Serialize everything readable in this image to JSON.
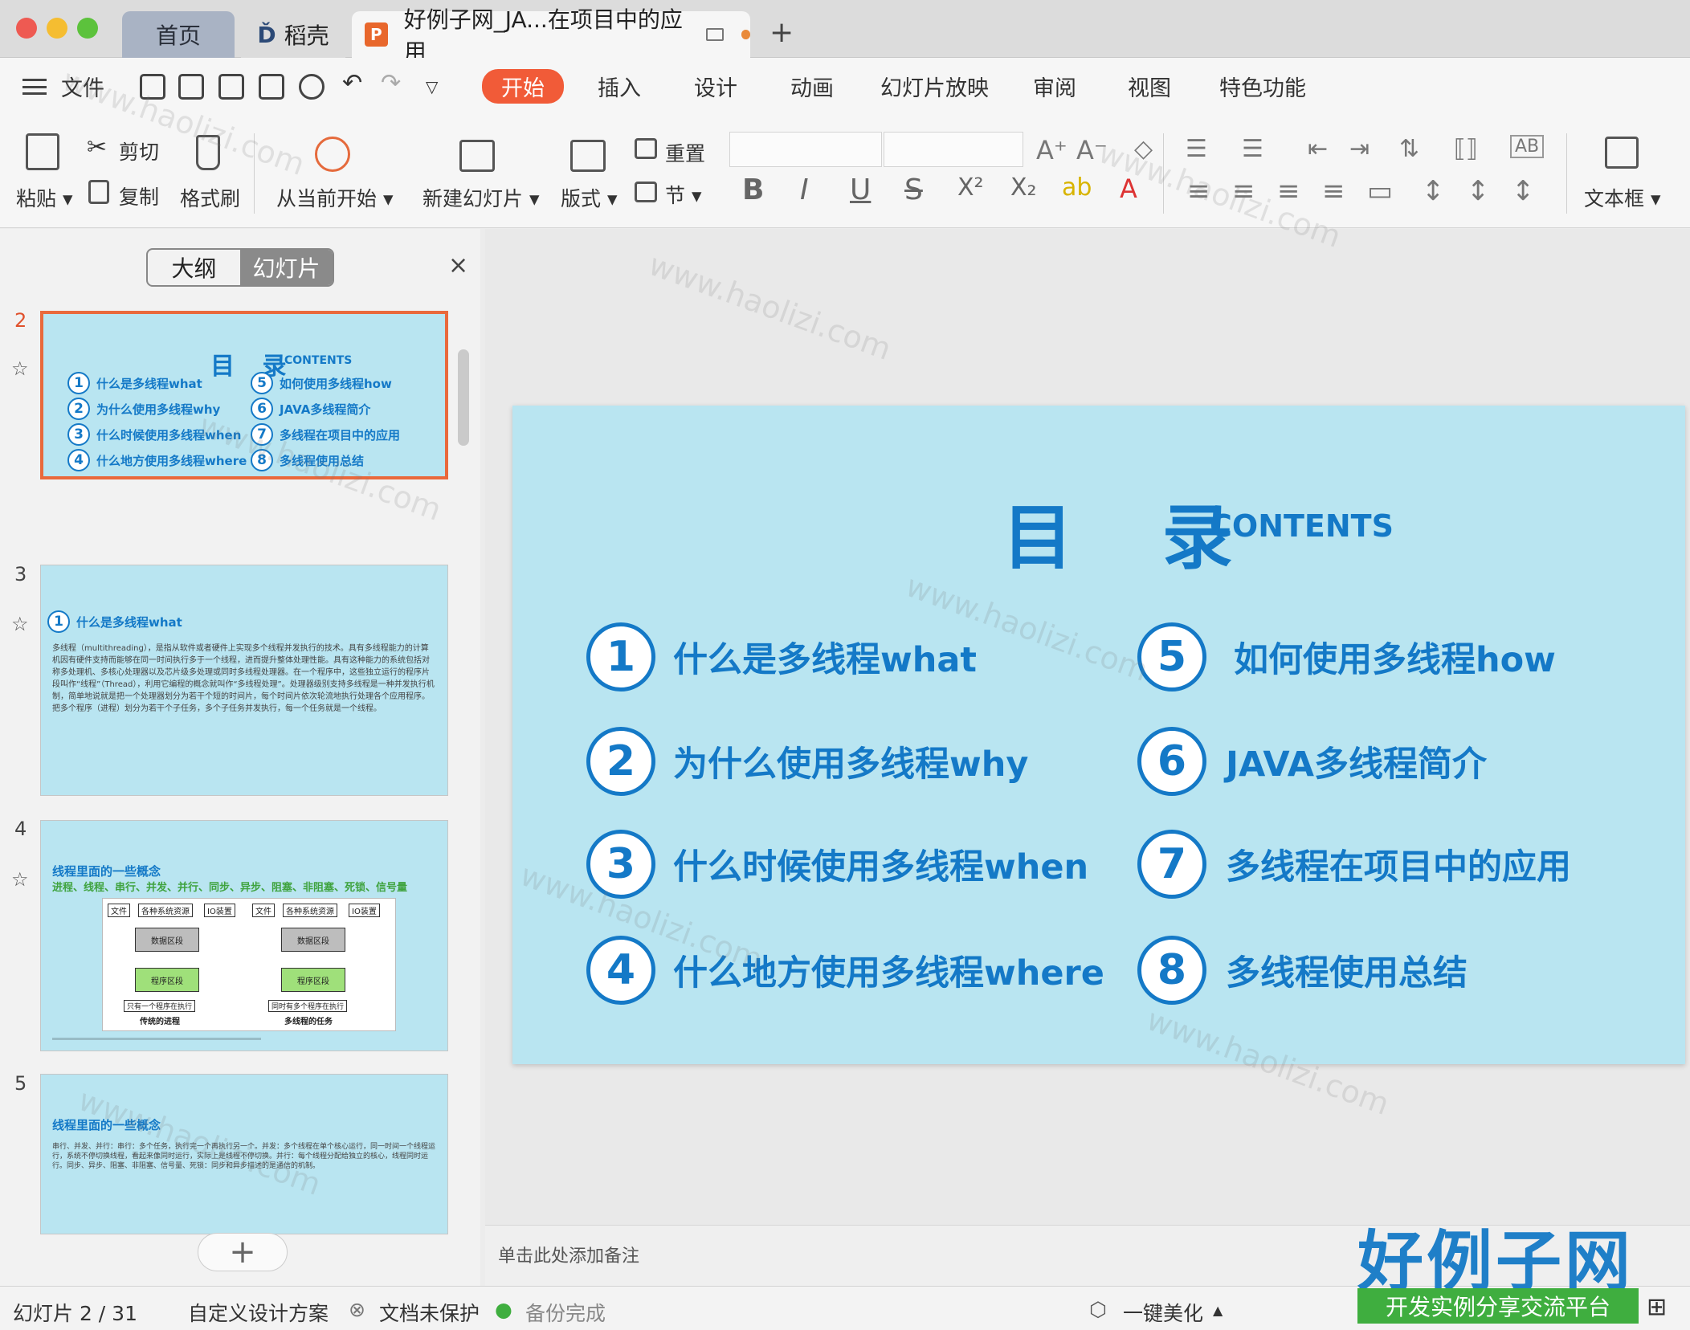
{
  "window": {
    "tabs": [
      {
        "label": "首页"
      },
      {
        "label": "稻壳"
      },
      {
        "label": "好例子网_JA...在项目中的应用",
        "badge": "P"
      }
    ],
    "new_tab": "+"
  },
  "menubar": {
    "file": "文件",
    "tabs": [
      "开始",
      "插入",
      "设计",
      "动画",
      "幻灯片放映",
      "审阅",
      "视图",
      "特色功能"
    ],
    "active": "开始"
  },
  "ribbon": {
    "paste": "粘贴",
    "cut": "剪切",
    "copy": "复制",
    "format_painter": "格式刷",
    "play_from_current": "从当前开始",
    "new_slide": "新建幻灯片",
    "layout": "版式",
    "reset": "重置",
    "section": "节",
    "textbox": "文本框",
    "bold": "B",
    "italic": "I",
    "underline": "U",
    "strike": "S"
  },
  "panel": {
    "outline_tab": "大纲",
    "slides_tab": "幻灯片",
    "close": "×",
    "add": "+"
  },
  "thumbnails": {
    "s2": {
      "num": "2"
    },
    "s3": {
      "num": "3",
      "heading": "什么是多线程what",
      "body": "多线程（multithreading），是指从软件或者硬件上实现多个线程并发执行的技术。具有多线程能力的计算机因有硬件支持而能够在同一时间执行多于一个线程，进而提升整体处理性能。具有这种能力的系统包括对称多处理机、多核心处理器以及芯片级多处理或同时多线程处理器。在一个程序中，这些独立运行的程序片段叫作“线程”（Thread），利用它编程的概念就叫作“多线程处理”。处理器级别支持多线程是一种并发执行机制，简单地说就是把一个处理器划分为若干个短的时间片，每个时间片依次轮流地执行处理各个应用程序。把多个程序（进程）划分为若干个子任务，多个子任务并发执行，每一个任务就是一个线程。"
    },
    "s4": {
      "num": "4",
      "heading": "线程里面的一些概念",
      "keywords": "进程、线程、串行、并发、并行、同步、异步、阻塞、非阻塞、死锁、信号量",
      "left_caption": "传统的进程",
      "right_caption": "多线程的任务",
      "box_file": "文件",
      "box_res": "各种系统资源",
      "box_io": "IO装置",
      "box_data": "数据区段",
      "box_prog": "程序区段",
      "note_single": "只有一个程序在执行",
      "note_multi": "同时有多个程序在执行"
    },
    "s5": {
      "num": "5",
      "heading": "线程里面的一些概念",
      "body": "串行、并发、并行：串行：多个任务，执行完一个再执行另一个。并发：多个线程在单个核心运行，同一时间一个线程运行，系统不停切换线程，看起来像同时运行，实际上是线程不停切换。并行：每个线程分配给独立的核心，线程同时运行。同步、异步、阻塞、非阻塞、信号量、死锁：同步和异步描述的是通信的机制。"
    }
  },
  "slide": {
    "title": "目 录",
    "subtitle": "CONTENTS",
    "items": [
      {
        "n": "1",
        "text": "什么是多线程what"
      },
      {
        "n": "2",
        "text": "为什么使用多线程why"
      },
      {
        "n": "3",
        "text": "什么时候使用多线程when"
      },
      {
        "n": "4",
        "text": "什么地方使用多线程where"
      },
      {
        "n": "5",
        "text": "如何使用多线程how"
      },
      {
        "n": "6",
        "text": "JAVA多线程简介"
      },
      {
        "n": "7",
        "text": "多线程在项目中的应用"
      },
      {
        "n": "8",
        "text": "多线程使用总结"
      }
    ]
  },
  "notes": {
    "placeholder": "单击此处添加备注"
  },
  "status": {
    "slide_counter": "幻灯片 2 / 31",
    "design": "自定义设计方案",
    "protect": "文档未保护",
    "backup": "备份完成",
    "beautify": "一键美化"
  },
  "watermark": {
    "text": "www.haolizi.com",
    "logo_main": "好例子网",
    "logo_sub": "开发实例分享交流平台"
  },
  "colors": {
    "accent": "#f15b38",
    "slide_bg": "#b9e5f1",
    "slide_text": "#1479c7"
  }
}
